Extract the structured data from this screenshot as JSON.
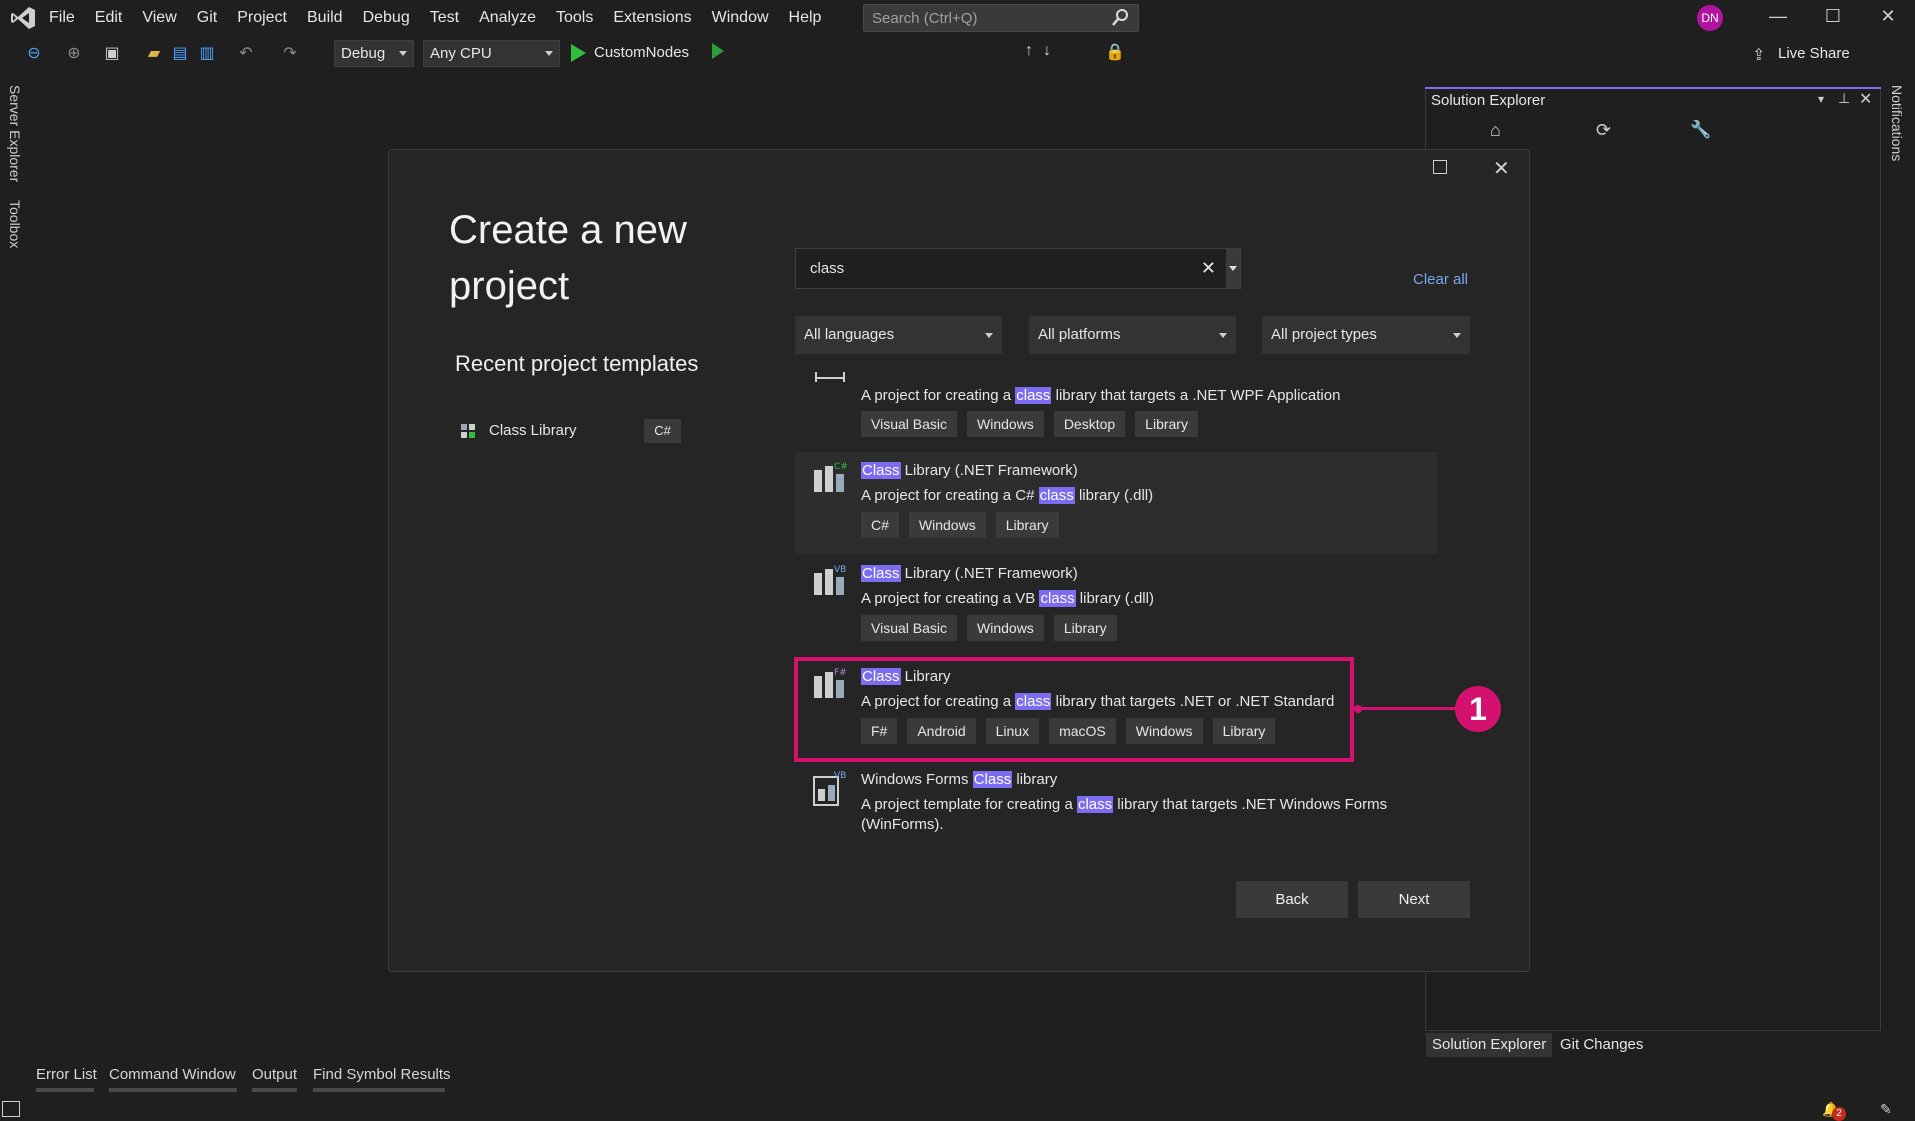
{
  "menu": [
    "File",
    "Edit",
    "View",
    "Git",
    "Project",
    "Build",
    "Debug",
    "Test",
    "Analyze",
    "Tools",
    "Extensions",
    "Window",
    "Help"
  ],
  "search_placeholder": "Search (Ctrl+Q)",
  "user_initials": "DN",
  "toolbar": {
    "config": "Debug",
    "platform": "Any CPU",
    "startup": "CustomNodes",
    "live_share": "Live Share"
  },
  "side_tabs": {
    "left1": "Server Explorer",
    "left2": "Toolbox",
    "right": "Notifications"
  },
  "solution_explorer": {
    "title": "Solution Explorer",
    "tabs": [
      "Solution Explorer",
      "Git Changes"
    ]
  },
  "bottom_tabs": [
    "Error List",
    "Command Window",
    "Output",
    "Find Symbol Results"
  ],
  "notifications_count": "2",
  "dialog": {
    "title": "Create a new project",
    "recent_heading": "Recent project templates",
    "recent": [
      {
        "label": "Class Library",
        "lang": "C#"
      }
    ],
    "search_value": "class",
    "clear_all": "Clear all",
    "filters": [
      "All languages",
      "All platforms",
      "All project types"
    ],
    "templates": [
      {
        "name_hl": "",
        "name_rest": "",
        "desc_pre": "A project for creating a ",
        "desc_hl": "class",
        "desc_post": " library that targets a .NET WPF Application",
        "tags": [
          "Visual Basic",
          "Windows",
          "Desktop",
          "Library"
        ]
      },
      {
        "name_hl": "Class",
        "name_rest": " Library (.NET Framework)",
        "desc_pre": "A project for creating a C# ",
        "desc_hl": "class",
        "desc_post": " library (.dll)",
        "tags": [
          "C#",
          "Windows",
          "Library"
        ],
        "badge": "C#"
      },
      {
        "name_hl": "Class",
        "name_rest": " Library (.NET Framework)",
        "desc_pre": "A project for creating a VB ",
        "desc_hl": "class",
        "desc_post": " library (.dll)",
        "tags": [
          "Visual Basic",
          "Windows",
          "Library"
        ],
        "badge": "VB"
      },
      {
        "name_hl": "Class",
        "name_rest": " Library",
        "desc_pre": "A project for creating a ",
        "desc_hl": "class",
        "desc_post": " library that targets .NET or .NET Standard",
        "tags": [
          "F#",
          "Android",
          "Linux",
          "macOS",
          "Windows",
          "Library"
        ],
        "badge": "F#"
      },
      {
        "name_pre": "Windows Forms ",
        "name_hl": "Class",
        "name_rest": " library",
        "desc_pre": "A project template for creating a ",
        "desc_hl": "class",
        "desc_post": " library that targets .NET Windows Forms (WinForms).",
        "tags": [],
        "badge": "VB"
      }
    ],
    "back": "Back",
    "next": "Next"
  },
  "callout_number": "1",
  "colors": {
    "accent": "#7b6cf2",
    "callout": "#d4116e",
    "link": "#79a8ec"
  }
}
